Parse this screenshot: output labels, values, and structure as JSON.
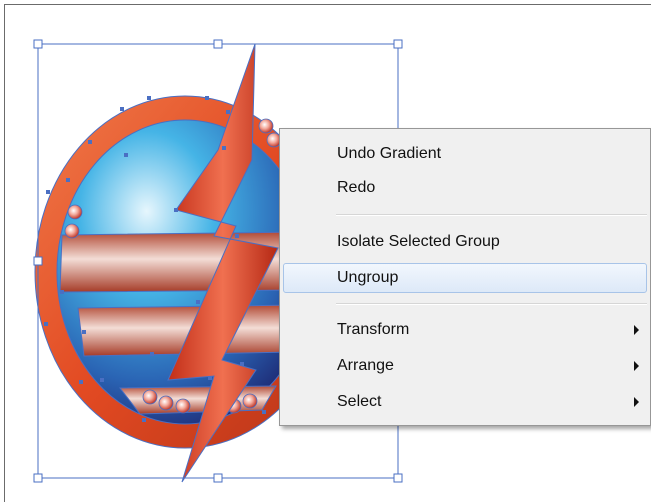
{
  "context_menu": {
    "group1": [
      {
        "label": "Undo Gradient",
        "submenu": false
      },
      {
        "label": "Redo",
        "submenu": false
      }
    ],
    "group2": [
      {
        "label": "Isolate Selected Group",
        "submenu": false
      },
      {
        "label": "Ungroup",
        "submenu": false,
        "highlighted": true
      }
    ],
    "group3": [
      {
        "label": "Transform",
        "submenu": true
      },
      {
        "label": "Arrange",
        "submenu": true
      },
      {
        "label": "Select",
        "submenu": true
      }
    ]
  },
  "artwork": {
    "colors": {
      "ring_orange": "#e8552a",
      "sphere_light": "#d8f0fb",
      "sphere_blue": "#2fa0dc",
      "sphere_dark": "#1f2f7a",
      "bolt_red": "#e04426",
      "band_silver": "#c9a39a",
      "selection_blue": "#4a6fc3"
    }
  }
}
